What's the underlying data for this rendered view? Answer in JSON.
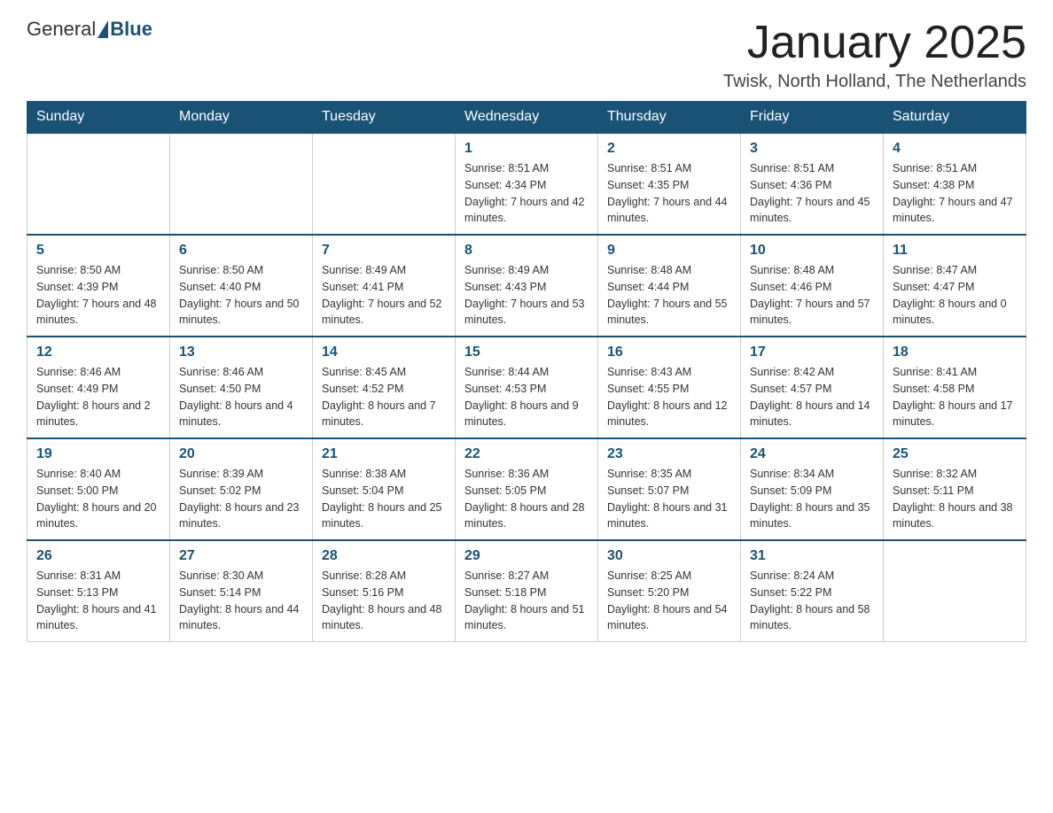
{
  "header": {
    "logo_general": "General",
    "logo_blue": "Blue",
    "month_title": "January 2025",
    "subtitle": "Twisk, North Holland, The Netherlands"
  },
  "weekdays": [
    "Sunday",
    "Monday",
    "Tuesday",
    "Wednesday",
    "Thursday",
    "Friday",
    "Saturday"
  ],
  "weeks": [
    [
      null,
      null,
      null,
      {
        "day": "1",
        "sunrise": "Sunrise: 8:51 AM",
        "sunset": "Sunset: 4:34 PM",
        "daylight": "Daylight: 7 hours and 42 minutes."
      },
      {
        "day": "2",
        "sunrise": "Sunrise: 8:51 AM",
        "sunset": "Sunset: 4:35 PM",
        "daylight": "Daylight: 7 hours and 44 minutes."
      },
      {
        "day": "3",
        "sunrise": "Sunrise: 8:51 AM",
        "sunset": "Sunset: 4:36 PM",
        "daylight": "Daylight: 7 hours and 45 minutes."
      },
      {
        "day": "4",
        "sunrise": "Sunrise: 8:51 AM",
        "sunset": "Sunset: 4:38 PM",
        "daylight": "Daylight: 7 hours and 47 minutes."
      }
    ],
    [
      {
        "day": "5",
        "sunrise": "Sunrise: 8:50 AM",
        "sunset": "Sunset: 4:39 PM",
        "daylight": "Daylight: 7 hours and 48 minutes."
      },
      {
        "day": "6",
        "sunrise": "Sunrise: 8:50 AM",
        "sunset": "Sunset: 4:40 PM",
        "daylight": "Daylight: 7 hours and 50 minutes."
      },
      {
        "day": "7",
        "sunrise": "Sunrise: 8:49 AM",
        "sunset": "Sunset: 4:41 PM",
        "daylight": "Daylight: 7 hours and 52 minutes."
      },
      {
        "day": "8",
        "sunrise": "Sunrise: 8:49 AM",
        "sunset": "Sunset: 4:43 PM",
        "daylight": "Daylight: 7 hours and 53 minutes."
      },
      {
        "day": "9",
        "sunrise": "Sunrise: 8:48 AM",
        "sunset": "Sunset: 4:44 PM",
        "daylight": "Daylight: 7 hours and 55 minutes."
      },
      {
        "day": "10",
        "sunrise": "Sunrise: 8:48 AM",
        "sunset": "Sunset: 4:46 PM",
        "daylight": "Daylight: 7 hours and 57 minutes."
      },
      {
        "day": "11",
        "sunrise": "Sunrise: 8:47 AM",
        "sunset": "Sunset: 4:47 PM",
        "daylight": "Daylight: 8 hours and 0 minutes."
      }
    ],
    [
      {
        "day": "12",
        "sunrise": "Sunrise: 8:46 AM",
        "sunset": "Sunset: 4:49 PM",
        "daylight": "Daylight: 8 hours and 2 minutes."
      },
      {
        "day": "13",
        "sunrise": "Sunrise: 8:46 AM",
        "sunset": "Sunset: 4:50 PM",
        "daylight": "Daylight: 8 hours and 4 minutes."
      },
      {
        "day": "14",
        "sunrise": "Sunrise: 8:45 AM",
        "sunset": "Sunset: 4:52 PM",
        "daylight": "Daylight: 8 hours and 7 minutes."
      },
      {
        "day": "15",
        "sunrise": "Sunrise: 8:44 AM",
        "sunset": "Sunset: 4:53 PM",
        "daylight": "Daylight: 8 hours and 9 minutes."
      },
      {
        "day": "16",
        "sunrise": "Sunrise: 8:43 AM",
        "sunset": "Sunset: 4:55 PM",
        "daylight": "Daylight: 8 hours and 12 minutes."
      },
      {
        "day": "17",
        "sunrise": "Sunrise: 8:42 AM",
        "sunset": "Sunset: 4:57 PM",
        "daylight": "Daylight: 8 hours and 14 minutes."
      },
      {
        "day": "18",
        "sunrise": "Sunrise: 8:41 AM",
        "sunset": "Sunset: 4:58 PM",
        "daylight": "Daylight: 8 hours and 17 minutes."
      }
    ],
    [
      {
        "day": "19",
        "sunrise": "Sunrise: 8:40 AM",
        "sunset": "Sunset: 5:00 PM",
        "daylight": "Daylight: 8 hours and 20 minutes."
      },
      {
        "day": "20",
        "sunrise": "Sunrise: 8:39 AM",
        "sunset": "Sunset: 5:02 PM",
        "daylight": "Daylight: 8 hours and 23 minutes."
      },
      {
        "day": "21",
        "sunrise": "Sunrise: 8:38 AM",
        "sunset": "Sunset: 5:04 PM",
        "daylight": "Daylight: 8 hours and 25 minutes."
      },
      {
        "day": "22",
        "sunrise": "Sunrise: 8:36 AM",
        "sunset": "Sunset: 5:05 PM",
        "daylight": "Daylight: 8 hours and 28 minutes."
      },
      {
        "day": "23",
        "sunrise": "Sunrise: 8:35 AM",
        "sunset": "Sunset: 5:07 PM",
        "daylight": "Daylight: 8 hours and 31 minutes."
      },
      {
        "day": "24",
        "sunrise": "Sunrise: 8:34 AM",
        "sunset": "Sunset: 5:09 PM",
        "daylight": "Daylight: 8 hours and 35 minutes."
      },
      {
        "day": "25",
        "sunrise": "Sunrise: 8:32 AM",
        "sunset": "Sunset: 5:11 PM",
        "daylight": "Daylight: 8 hours and 38 minutes."
      }
    ],
    [
      {
        "day": "26",
        "sunrise": "Sunrise: 8:31 AM",
        "sunset": "Sunset: 5:13 PM",
        "daylight": "Daylight: 8 hours and 41 minutes."
      },
      {
        "day": "27",
        "sunrise": "Sunrise: 8:30 AM",
        "sunset": "Sunset: 5:14 PM",
        "daylight": "Daylight: 8 hours and 44 minutes."
      },
      {
        "day": "28",
        "sunrise": "Sunrise: 8:28 AM",
        "sunset": "Sunset: 5:16 PM",
        "daylight": "Daylight: 8 hours and 48 minutes."
      },
      {
        "day": "29",
        "sunrise": "Sunrise: 8:27 AM",
        "sunset": "Sunset: 5:18 PM",
        "daylight": "Daylight: 8 hours and 51 minutes."
      },
      {
        "day": "30",
        "sunrise": "Sunrise: 8:25 AM",
        "sunset": "Sunset: 5:20 PM",
        "daylight": "Daylight: 8 hours and 54 minutes."
      },
      {
        "day": "31",
        "sunrise": "Sunrise: 8:24 AM",
        "sunset": "Sunset: 5:22 PM",
        "daylight": "Daylight: 8 hours and 58 minutes."
      },
      null
    ]
  ]
}
